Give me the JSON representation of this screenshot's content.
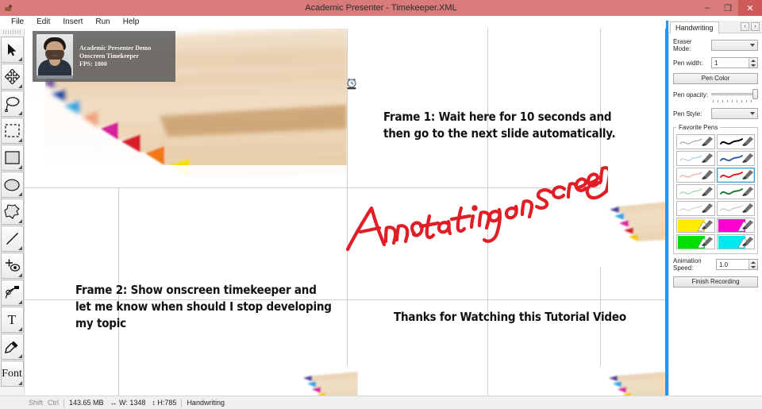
{
  "window": {
    "title": "Academic Presenter - Timekeeper.XML",
    "app_icon": "presenter-icon",
    "minimize_label": "–",
    "restore_label": "❐",
    "close_label": "✕",
    "titlebar_color": "#d97b7b",
    "accent_color": "#2196f3"
  },
  "menubar": {
    "items": [
      {
        "label": "File"
      },
      {
        "label": "Edit"
      },
      {
        "label": "Insert"
      },
      {
        "label": "Run"
      },
      {
        "label": "Help"
      }
    ]
  },
  "toolbar": {
    "tools": [
      {
        "name": "select-arrow-tool",
        "icon": "cursor-arrow-icon"
      },
      {
        "name": "move-tool",
        "icon": "four-way-arrow-icon"
      },
      {
        "name": "lasso-tool",
        "icon": "lasso-icon"
      },
      {
        "name": "marquee-select-tool",
        "icon": "dashed-rectangle-icon"
      },
      {
        "name": "rectangle-tool",
        "icon": "rectangle-icon"
      },
      {
        "name": "ellipse-tool",
        "icon": "ellipse-icon"
      },
      {
        "name": "freeform-shape-tool",
        "icon": "blob-shape-icon"
      },
      {
        "name": "line-tool",
        "icon": "diagonal-line-icon"
      },
      {
        "name": "add-view-tool",
        "icon": "plus-eye-icon"
      },
      {
        "name": "path-node-tool",
        "icon": "bezier-node-icon"
      },
      {
        "name": "text-tool",
        "icon": "text-t-icon",
        "glyph": "T"
      },
      {
        "name": "eyedropper-tool",
        "icon": "eyedropper-icon"
      },
      {
        "name": "font-tool",
        "icon": "font-icon",
        "glyph": "Font"
      }
    ]
  },
  "canvas": {
    "overlay": {
      "title": "Academic Presenter Demo",
      "subtitle": "Onscreen Timekeeper",
      "fps": "FPS: 1000",
      "avatar": "presenter-avatar"
    },
    "clock_icon": "alarm-clock-icon",
    "texts": [
      {
        "name": "slide-text-frame1",
        "lines": [
          "Frame 1: Wait here for 10 seconds and",
          "then go to the next slide automatically."
        ]
      },
      {
        "name": "slide-text-frame2",
        "lines": [
          "Frame 2: Show onscreen timekeeper and",
          "let me know when should I stop developing",
          "my topic"
        ]
      },
      {
        "name": "slide-text-thanks",
        "lines": [
          "Thanks for Watching this Tutorial Video"
        ]
      }
    ],
    "annotation": {
      "text": "Annotating on screen",
      "color": "#e11d26",
      "name": "handwriting-annotation"
    }
  },
  "rightpanel": {
    "tab": {
      "label": "Handwriting"
    },
    "tab_prev": "‹",
    "tab_next": "›",
    "eraser_mode": {
      "label": "Eraser Mode:",
      "value": ""
    },
    "pen_width": {
      "label": "Pen width:",
      "value": "1"
    },
    "pen_color_button": "Pen Color",
    "pen_opacity": {
      "label": "Pen opacity:",
      "value": "100"
    },
    "pen_style": {
      "label": "Pen Style:",
      "value": ""
    },
    "favorite_pens": {
      "legend": "Favorite Pens",
      "pens": [
        {
          "name": "pen-gray-thin",
          "color": "#9a9a9a",
          "style": "stroke",
          "selected": false
        },
        {
          "name": "pen-black-thick",
          "color": "#000000",
          "style": "stroke",
          "selected": false
        },
        {
          "name": "pen-lightblue",
          "color": "#9fc6e8",
          "style": "stroke",
          "selected": false
        },
        {
          "name": "pen-blue",
          "color": "#2f5fa8",
          "style": "stroke",
          "selected": false
        },
        {
          "name": "pen-pink",
          "color": "#f09a9a",
          "style": "stroke",
          "selected": false
        },
        {
          "name": "pen-red",
          "color": "#e11d26",
          "style": "stroke",
          "selected": true
        },
        {
          "name": "pen-lightgreen",
          "color": "#8fcf8f",
          "style": "stroke",
          "selected": false
        },
        {
          "name": "pen-green",
          "color": "#1f7a34",
          "style": "stroke",
          "selected": false
        },
        {
          "name": "pen-lightgray",
          "color": "#cccccc",
          "style": "stroke",
          "selected": false
        },
        {
          "name": "pen-silver",
          "color": "#bdbdbd",
          "style": "stroke",
          "selected": false
        },
        {
          "name": "highlighter-yellow",
          "color": "#ffec00",
          "style": "fill",
          "selected": false
        },
        {
          "name": "highlighter-magenta",
          "color": "#ff00d0",
          "style": "fill",
          "selected": false
        },
        {
          "name": "highlighter-green",
          "color": "#00e000",
          "style": "fill",
          "selected": false
        },
        {
          "name": "highlighter-cyan",
          "color": "#00e8f0",
          "style": "fill",
          "selected": false
        }
      ]
    },
    "animation_speed": {
      "label": "Animation Speed:",
      "value": "1.0"
    },
    "finish_recording_button": "Finish Recording"
  },
  "statusbar": {
    "shift": "Shift",
    "ctrl": "Ctrl",
    "memory": "143.65 MB",
    "width": "↔ W: 1348",
    "height": "↕ H:785",
    "mode": "Handwriting"
  }
}
